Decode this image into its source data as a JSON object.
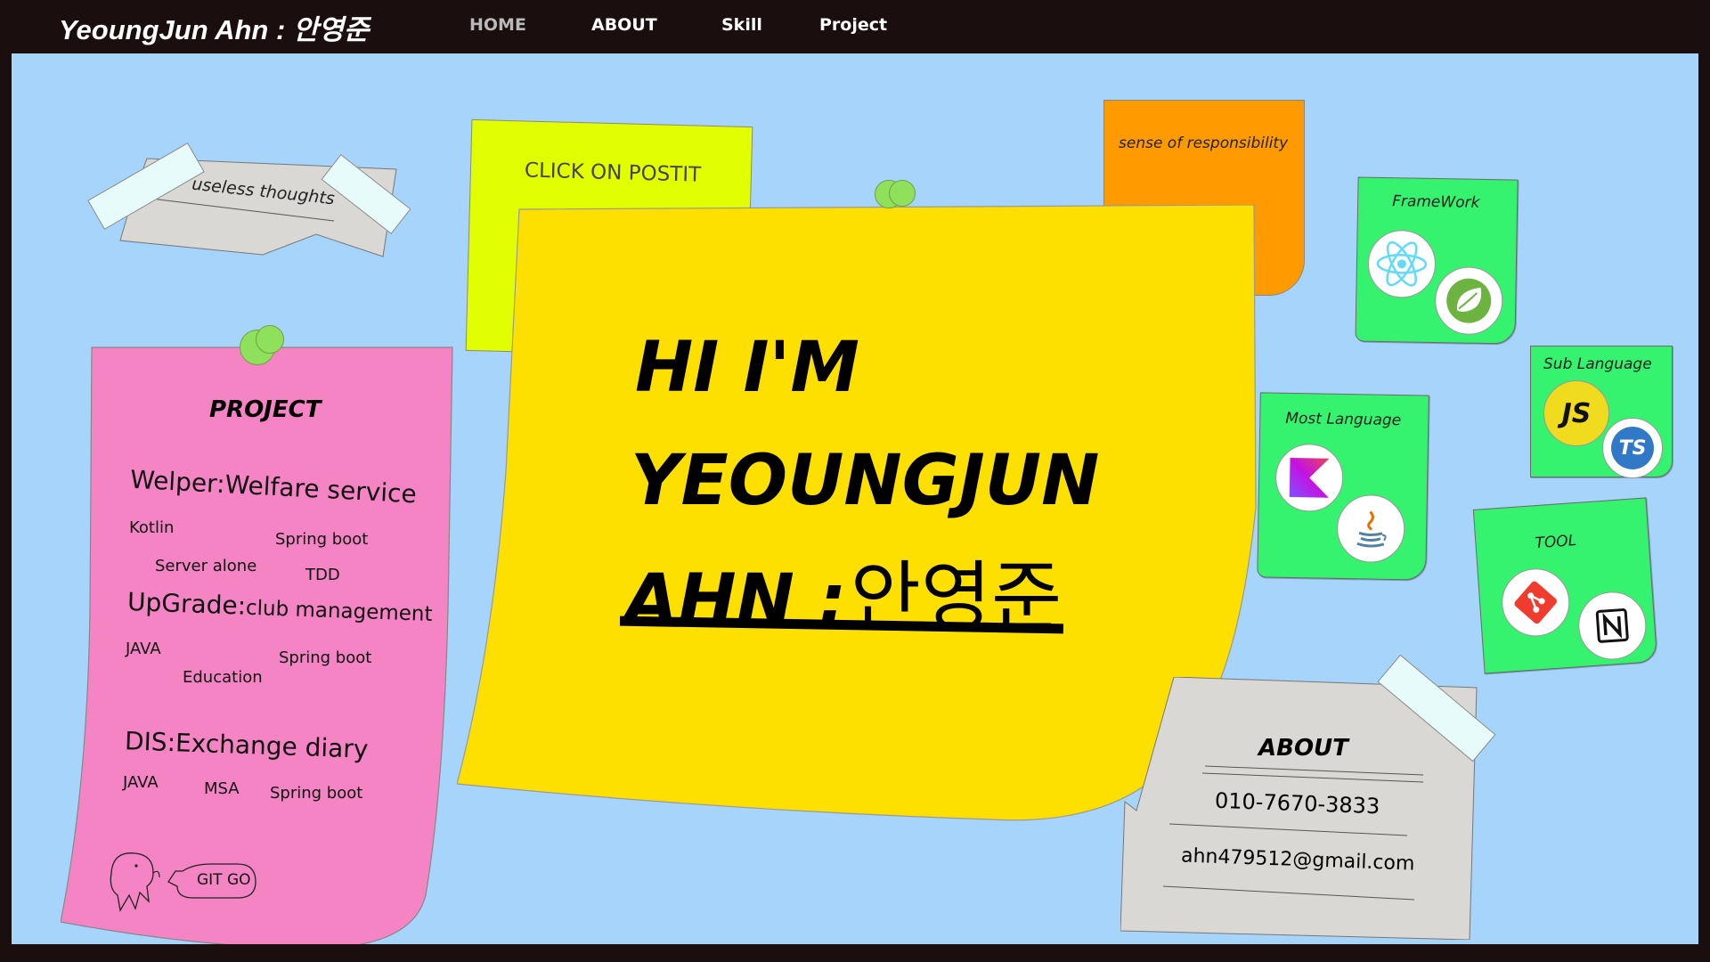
{
  "brand": {
    "title": "YeoungJun Ahn : 안영준"
  },
  "nav": {
    "items": [
      "HOME",
      "ABOUT",
      "Skill",
      "Project"
    ]
  },
  "notes": {
    "useless": "useless thoughts",
    "click": "CLICK ON POSTIT",
    "responsibility": "sense of responsibility",
    "framework": "FrameWork",
    "sub_language": "Sub Language",
    "most_language": "Most Language",
    "tool": "TOOL"
  },
  "hero": {
    "line1": "HI I'M",
    "line2": "YEOUNGJUN",
    "line3_latin": "AHN :",
    "line3_korean": "안영준"
  },
  "project": {
    "title": "PROJECT",
    "items": [
      {
        "name": "Welper:Welfare service",
        "tags": [
          "Kotlin",
          "Spring boot",
          "Server alone",
          "TDD"
        ]
      },
      {
        "name_main": "UpGrade:",
        "name_sub": "club management",
        "tags": [
          "JAVA",
          "Spring boot",
          "Education"
        ]
      },
      {
        "name": "DIS:Exchange diary",
        "tags": [
          "JAVA",
          "MSA",
          "Spring boot"
        ]
      }
    ],
    "git_button": "GIT GO"
  },
  "about": {
    "title": "ABOUT",
    "phone": "010-7670-3833",
    "email": "ahn479512@gmail.com"
  },
  "icons": {
    "framework": [
      "react-icon",
      "spring-icon"
    ],
    "most_language": [
      "kotlin-icon",
      "java-icon"
    ],
    "sub_language": [
      "javascript-icon",
      "typescript-icon"
    ],
    "tool": [
      "git-icon",
      "notion-icon"
    ],
    "js_label": "JS",
    "ts_label": "TS"
  },
  "colors": {
    "board": "#a6d4fb",
    "main_note": "#fde000",
    "project_note": "#f484c4",
    "click_note": "#e2ff00",
    "responsibility_note": "#ff9b00",
    "skill_note": "#35f26f"
  }
}
